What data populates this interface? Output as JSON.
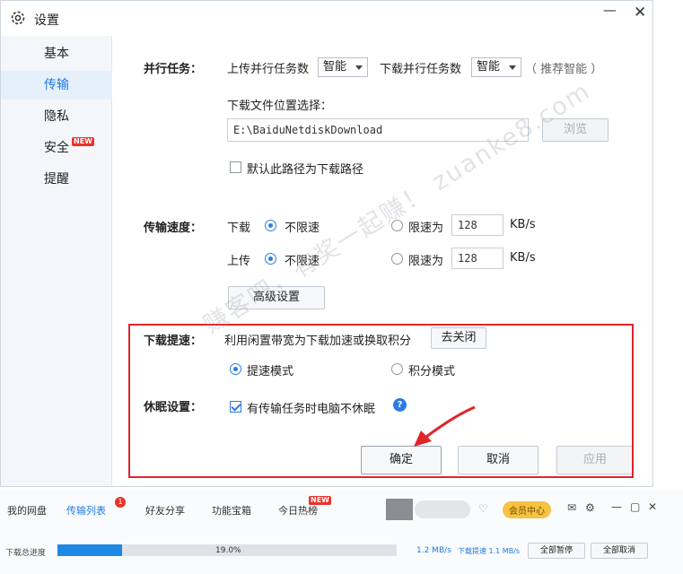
{
  "window": {
    "title": "设置",
    "minimize_symbol": "—",
    "close_symbol": "✕"
  },
  "sidebar": {
    "items": [
      {
        "label": "基本"
      },
      {
        "label": "传输"
      },
      {
        "label": "隐私"
      },
      {
        "label": "安全"
      },
      {
        "label": "提醒"
      }
    ],
    "new_badge": "NEW"
  },
  "parallel": {
    "label": "并行任务：",
    "upload_label": "上传并行任务数",
    "upload_value": "智能",
    "download_label": "下载并行任务数",
    "download_value": "智能",
    "hint": "（ 推荐智能 ）"
  },
  "location": {
    "label": "下载文件位置选择：",
    "path": "E:\\BaiduNetdiskDownload",
    "browse": "浏览",
    "default_checkbox": "默认此路径为下载路径"
  },
  "speed": {
    "label": "传输速度：",
    "download_label": "下载",
    "upload_label": "上传",
    "unlimited": "不限速",
    "limit_label": "限速为",
    "download_limit": "128",
    "upload_limit": "128",
    "unit": "KB/s",
    "advanced": "高级设置"
  },
  "boost": {
    "label": "下载提速：",
    "desc": "利用闲置带宽为下载加速或换取积分",
    "close_btn": "去关闭",
    "mode_speed": "提速模式",
    "mode_points": "积分模式"
  },
  "sleep": {
    "label": "休眠设置：",
    "checkbox": "有传输任务时电脑不休眠",
    "help": "?"
  },
  "actions": {
    "ok": "确定",
    "cancel": "取消",
    "apply": "应用"
  },
  "watermark": "赚客吧，有奖一起赚！ zuanke8.com",
  "bottom": {
    "tabs": [
      "我的网盘",
      "传输列表",
      "好友分享",
      "功能宝箱",
      "今日热榜"
    ],
    "tab_badge": "1",
    "hot_badge": "NEW",
    "vip": "会员中心",
    "progress_label": "下载总进度",
    "progress_percent": "19.0%",
    "progress_value": 0.19,
    "speed": "1.2 MB/s",
    "speed_boost": "下载提速 1.1 MB/s",
    "pause_all": "全部暂停",
    "cancel_all": "全部取消"
  },
  "colors": {
    "accent": "#1e7ae6",
    "red_highlight": "#e0252b",
    "arrow": "#e0252b"
  }
}
